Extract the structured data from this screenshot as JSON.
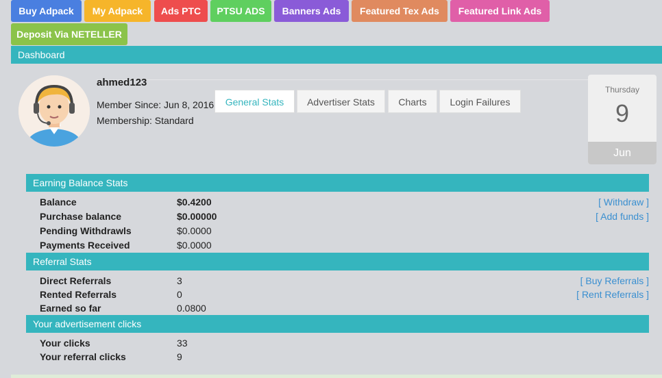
{
  "nav": {
    "buttons": [
      {
        "label": "Buy Adpack",
        "color": "#4a7fe0"
      },
      {
        "label": "My Adpack",
        "color": "#f6b52a"
      },
      {
        "label": "Ads PTC",
        "color": "#ee4d4d"
      },
      {
        "label": "PTSU ADS",
        "color": "#5fcf5f"
      },
      {
        "label": "Banners Ads",
        "color": "#8a5bd8"
      },
      {
        "label": "Featured Tex Ads",
        "color": "#e08a5f"
      },
      {
        "label": "Featured Link Ads",
        "color": "#e05fa8"
      },
      {
        "label": "Deposit Via NETELLER",
        "color": "#8bc34a"
      }
    ]
  },
  "dashboard": {
    "title": "Dashboard"
  },
  "profile": {
    "username": "ahmed123",
    "member_since": "Member Since: Jun 8, 2016",
    "membership": "Membership: Standard"
  },
  "tabs": [
    {
      "label": "General Stats"
    },
    {
      "label": "Advertiser Stats"
    },
    {
      "label": "Charts"
    },
    {
      "label": "Login Failures"
    }
  ],
  "date": {
    "weekday": "Thursday",
    "day": "9",
    "month": "Jun"
  },
  "earning": {
    "title": "Earning Balance Stats",
    "rows": [
      {
        "label": "Balance",
        "value": "$0.4200",
        "link": "[ Withdraw ]"
      },
      {
        "label": "Purchase balance",
        "value": "$0.00000",
        "link": "[ Add funds ]"
      },
      {
        "label": "Pending Withdrawls",
        "value": "$0.0000"
      },
      {
        "label": "Payments Received",
        "value": "$0.0000"
      }
    ]
  },
  "referral": {
    "title": "Referral Stats",
    "rows": [
      {
        "label": "Direct Referrals",
        "value": "3",
        "link": "[ Buy Referrals ]"
      },
      {
        "label": "Rented Referrals",
        "value": "0",
        "link": "[ Rent Referrals ]"
      },
      {
        "label": "Earned so far",
        "value": "0.0800"
      }
    ]
  },
  "clicks": {
    "title": "Your advertisement clicks",
    "rows": [
      {
        "label": "Your clicks",
        "value": "33"
      },
      {
        "label": "Your referral clicks",
        "value": "9"
      }
    ]
  }
}
